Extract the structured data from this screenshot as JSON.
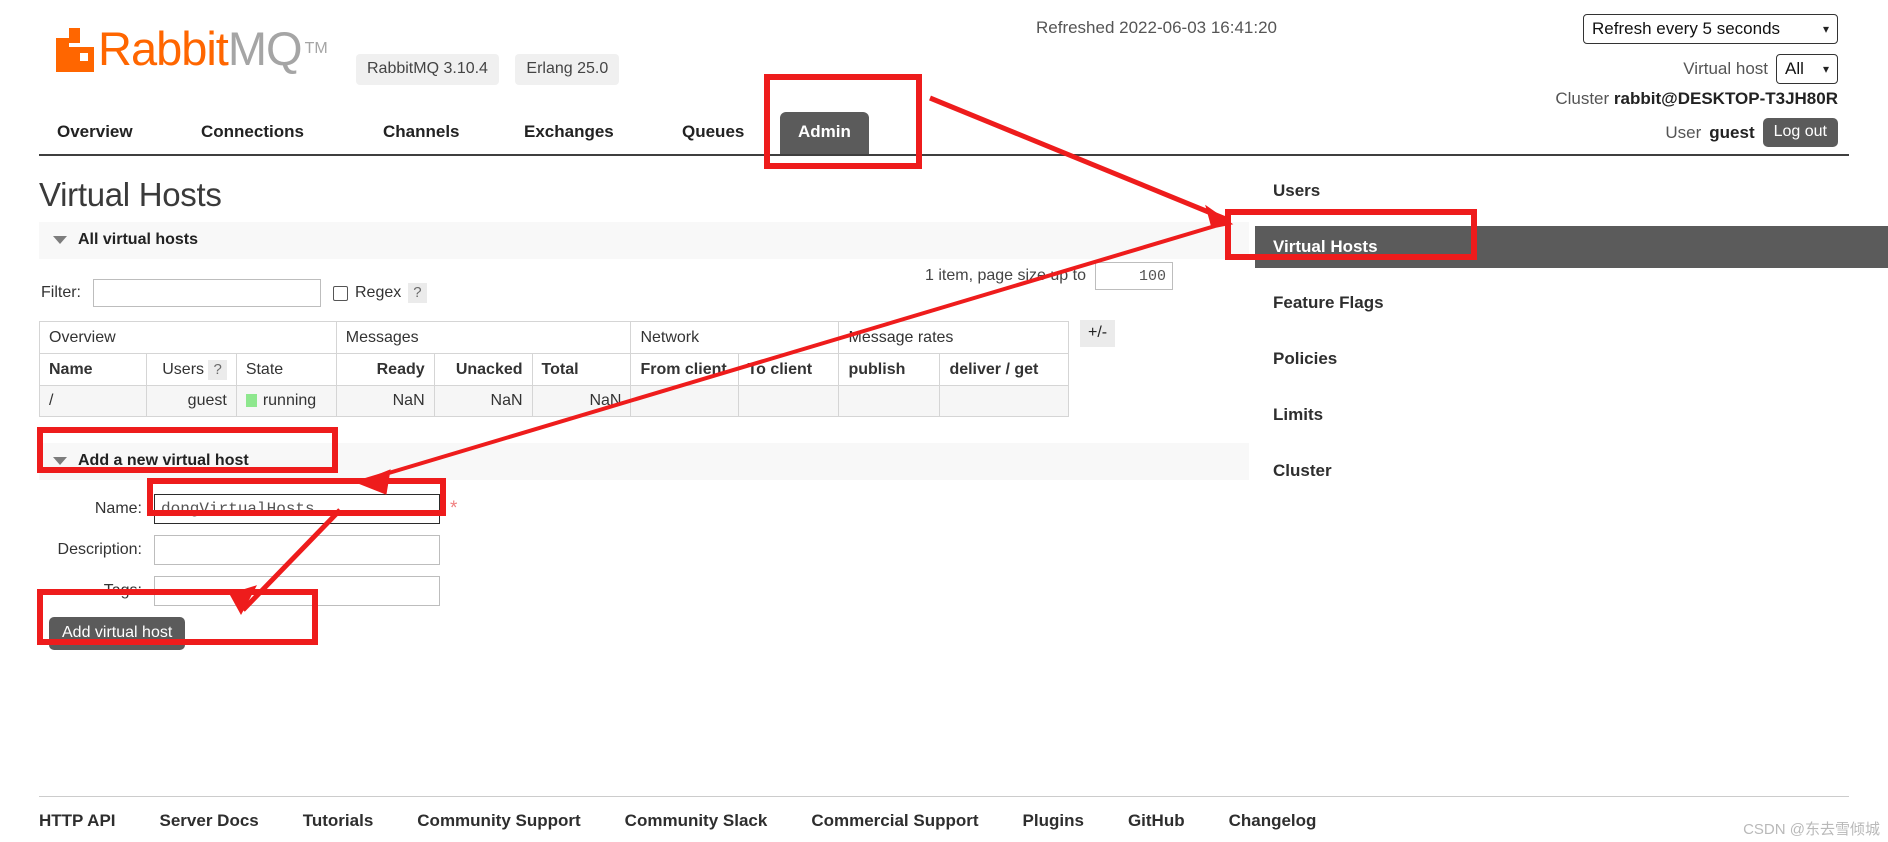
{
  "header": {
    "logo": {
      "rabbit": "Rabbit",
      "mq": "MQ",
      "tm": "TM",
      "icon": "rabbitmq-logo-icon"
    },
    "badges": [
      "RabbitMQ 3.10.4",
      "Erlang 25.0"
    ],
    "refreshed_label": "Refreshed 2022-06-03 16:41:20",
    "refresh_select": {
      "value": "Refresh every 5 seconds",
      "chevron": "chevron-down-icon"
    },
    "vhost_label": "Virtual host",
    "vhost_select": {
      "value": "All",
      "chevron": "chevron-down-icon"
    },
    "cluster_label": "Cluster",
    "cluster_value": "rabbit@DESKTOP-T3JH80R",
    "user_label": "User",
    "user_value": "guest",
    "logout_label": "Log out"
  },
  "nav": {
    "tabs": [
      {
        "label": "Overview",
        "active": false
      },
      {
        "label": "Connections",
        "active": false
      },
      {
        "label": "Channels",
        "active": false
      },
      {
        "label": "Exchanges",
        "active": false
      },
      {
        "label": "Queues",
        "active": false
      },
      {
        "label": "Admin",
        "active": true
      }
    ]
  },
  "main": {
    "page_title": "Virtual Hosts",
    "all_vhosts_section": "All virtual hosts",
    "filter_label": "Filter:",
    "filter_value": "",
    "filter_placeholder": "",
    "regex_label": "Regex",
    "regex_checked": false,
    "help_mark": "?",
    "items_text": "1 item, page size up to",
    "page_size": "100",
    "plus_minus": "+/-",
    "table": {
      "groups": [
        {
          "label": "Overview",
          "span": 3
        },
        {
          "label": "Messages",
          "span": 3
        },
        {
          "label": "Network",
          "span": 2
        },
        {
          "label": "Message rates",
          "span": 2
        }
      ],
      "columns": [
        {
          "label": "Name",
          "bold": true,
          "align": "left"
        },
        {
          "label": "Users",
          "bold": false,
          "align": "right",
          "help": "?"
        },
        {
          "label": "State",
          "bold": false,
          "align": "left"
        },
        {
          "label": "Ready",
          "bold": true,
          "align": "right"
        },
        {
          "label": "Unacked",
          "bold": true,
          "align": "right"
        },
        {
          "label": "Total",
          "bold": true,
          "align": "left"
        },
        {
          "label": "From client",
          "bold": true,
          "align": "left"
        },
        {
          "label": "To client",
          "bold": true,
          "align": "left"
        },
        {
          "label": "publish",
          "bold": true,
          "align": "left"
        },
        {
          "label": "deliver / get",
          "bold": true,
          "align": "left"
        }
      ],
      "rows": [
        {
          "name": "/",
          "users": "guest",
          "state": "running",
          "state_color": "#8ee78e",
          "ready": "NaN",
          "unacked": "NaN",
          "total": "NaN",
          "from_client": "",
          "to_client": "",
          "publish": "",
          "deliver_get": ""
        }
      ]
    },
    "add_form": {
      "section_title": "Add a new virtual host",
      "name_label": "Name:",
      "name_value": "dongVirtualHosts",
      "name_required": "*",
      "description_label": "Description:",
      "description_value": "",
      "tags_label": "Tags:",
      "tags_value": "",
      "submit_label": "Add virtual host"
    }
  },
  "sidebar": {
    "items": [
      {
        "label": "Users",
        "active": false
      },
      {
        "label": "Virtual Hosts",
        "active": true
      },
      {
        "label": "Feature Flags",
        "active": false
      },
      {
        "label": "Policies",
        "active": false
      },
      {
        "label": "Limits",
        "active": false
      },
      {
        "label": "Cluster",
        "active": false
      }
    ]
  },
  "footer": {
    "links": [
      "HTTP API",
      "Server Docs",
      "Tutorials",
      "Community Support",
      "Community Slack",
      "Commercial Support",
      "Plugins",
      "GitHub",
      "Changelog"
    ]
  },
  "watermark": "CSDN @东去雪倾城",
  "colors": {
    "brand_orange": "#ff6600",
    "accent_grey": "#5b5b5b",
    "annotation_red": "#ee1c1c",
    "running_green": "#8ee78e",
    "required_red": "#f08080"
  }
}
